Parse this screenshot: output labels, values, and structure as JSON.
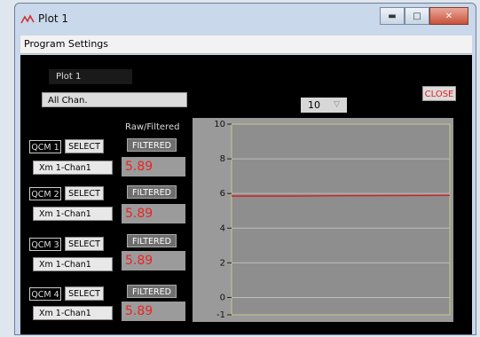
{
  "window": {
    "title": "Plot 1"
  },
  "menu": {
    "program_settings": "Program Settings"
  },
  "controls": {
    "plot_name": "Plot 1",
    "channel_mode": "All Chan.",
    "count_value": "10",
    "close_label": "CLOSE",
    "raw_filtered_header": "Raw/Filtered"
  },
  "channels": [
    {
      "qcm": "QCM 1",
      "select": "SELECT",
      "filter": "FILTERED",
      "chan": "Xm 1-Chan1",
      "value": "5.89"
    },
    {
      "qcm": "QCM 2",
      "select": "SELECT",
      "filter": "FILTERED",
      "chan": "Xm 1-Chan1",
      "value": "5.89"
    },
    {
      "qcm": "QCM 3",
      "select": "SELECT",
      "filter": "FILTERED",
      "chan": "Xm 1-Chan1",
      "value": "5.89"
    },
    {
      "qcm": "QCM 4",
      "select": "SELECT",
      "filter": "FILTERED",
      "chan": "Xm 1-Chan1",
      "value": "5.89"
    }
  ],
  "chart_data": {
    "type": "line",
    "title": "",
    "xlabel": "",
    "ylabel": "",
    "ylim": [
      -1,
      10
    ],
    "yticks": [
      "10",
      "8",
      "6",
      "4",
      "2",
      "0",
      "-1"
    ],
    "grid": true,
    "series": [
      {
        "x": [
          0,
          0.25,
          0.5,
          0.75,
          1.0
        ],
        "values": [
          5.85,
          5.85,
          5.87,
          5.88,
          5.89
        ],
        "color": "#d22222"
      }
    ]
  },
  "colors": {
    "accent_red": "#e02020",
    "panel_bg": "#000000",
    "plot_bg": "#9a9a9a"
  }
}
